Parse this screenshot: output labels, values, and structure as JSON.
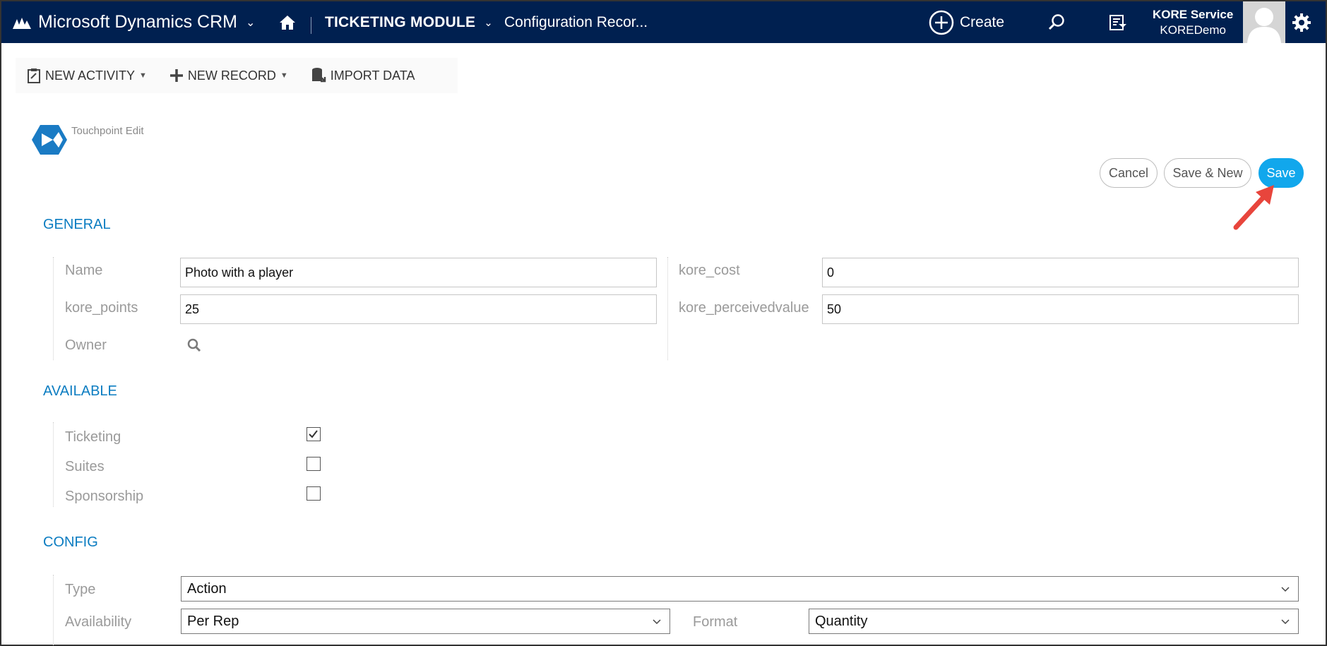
{
  "nav": {
    "brand": "Microsoft Dynamics CRM",
    "module": "TICKETING MODULE",
    "breadcrumb": "Configuration Recor...",
    "create_label": "Create",
    "user_name": "KORE Service",
    "user_org": "KOREDemo"
  },
  "commands": {
    "new_activity": "NEW ACTIVITY",
    "new_record": "NEW RECORD",
    "import_data": "IMPORT DATA"
  },
  "entity": {
    "title": "Touchpoint Edit"
  },
  "actions": {
    "cancel": "Cancel",
    "save_new": "Save & New",
    "save": "Save"
  },
  "general": {
    "title": "GENERAL",
    "name_label": "Name",
    "name_value": "Photo with a player",
    "cost_label": "kore_cost",
    "cost_value": "0",
    "points_label": "kore_points",
    "points_value": "25",
    "perceived_label": "kore_perceivedvalue",
    "perceived_value": "50",
    "owner_label": "Owner"
  },
  "available": {
    "title": "AVAILABLE",
    "items": [
      {
        "label": "Ticketing",
        "checked": true
      },
      {
        "label": "Suites",
        "checked": false
      },
      {
        "label": "Sponsorship",
        "checked": false
      }
    ]
  },
  "config": {
    "title": "CONFIG",
    "type_label": "Type",
    "type_value": "Action",
    "availability_label": "Availability",
    "availability_value": "Per Rep",
    "format_label": "Format",
    "format_value": "Quantity"
  },
  "colors": {
    "nav_bg": "#002050",
    "accent": "#0a7cc1",
    "save_button": "#11a7ec",
    "annotation_arrow": "#e8453c"
  }
}
